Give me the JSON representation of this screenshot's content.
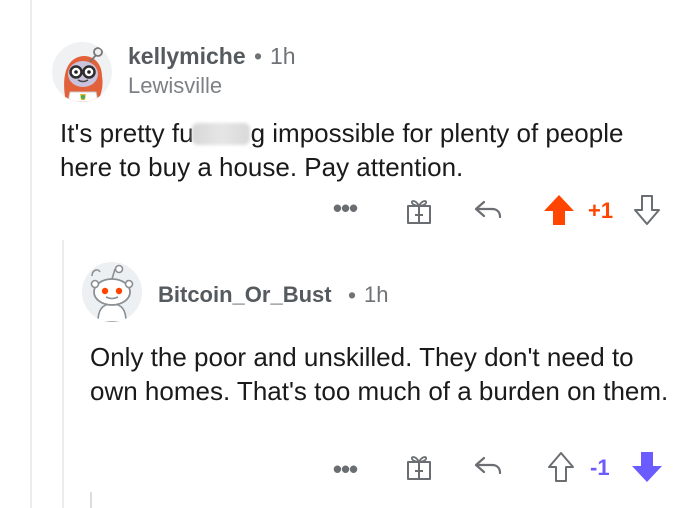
{
  "comments": [
    {
      "username": "kellymiche",
      "separator": "•",
      "time": "1h",
      "flair": "Lewisville",
      "body_before": "It's pretty fu",
      "body_after": "g impossible for plenty of people here to buy a house. Pay attention.",
      "score": "+1",
      "vote_state": "upvoted",
      "vote_color": "#ff4500",
      "icons": [
        "more-options-icon",
        "gift-award-icon",
        "reply-icon",
        "upvote-arrow-icon",
        "downvote-arrow-icon"
      ]
    },
    {
      "username": "Bitcoin_Or_Bust",
      "separator": "•",
      "time": "1h",
      "body": "Only the poor and unskilled. They don't need to own homes. That's too much of a burden on them.",
      "score": "-1",
      "vote_state": "downvoted",
      "vote_color": "#6a5cff",
      "icons": [
        "more-options-icon",
        "gift-award-icon",
        "reply-icon",
        "upvote-arrow-icon",
        "downvote-arrow-icon"
      ]
    }
  ],
  "ui": {
    "more_label": "•••"
  }
}
